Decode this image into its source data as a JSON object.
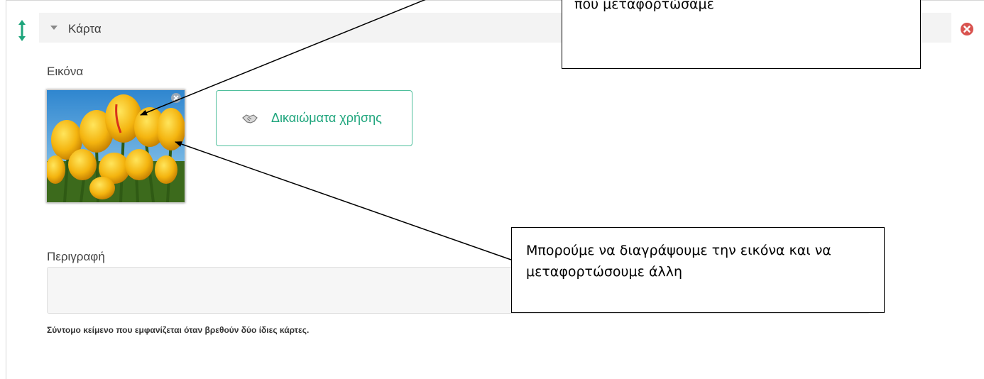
{
  "card": {
    "header_title": "Κάρτα",
    "image_label": "Εικόνα",
    "rights_button": "Δικαιώματα χρήσης",
    "description_label": "Περιγραφή",
    "description_value": "",
    "help_text": "Σύντομο κείμενο που εμφανίζεται όταν βρεθούν δύο ίδιες κάρτες."
  },
  "callouts": {
    "top_text": "που μεταφορτώσαμε",
    "bottom_text": "Μπορούμε να διαγράψουμε την εικόνα και να μεταφορτώσουμε άλλη"
  },
  "colors": {
    "accent": "#1ea57c",
    "remove": "#d9534f",
    "header_bg": "#f3f3f3"
  },
  "icons": {
    "drag": "drag-handle-icon",
    "collapse": "chevron-down-icon",
    "remove": "remove-circle-icon",
    "rights": "handshake-icon",
    "image_delete": "close-icon"
  }
}
